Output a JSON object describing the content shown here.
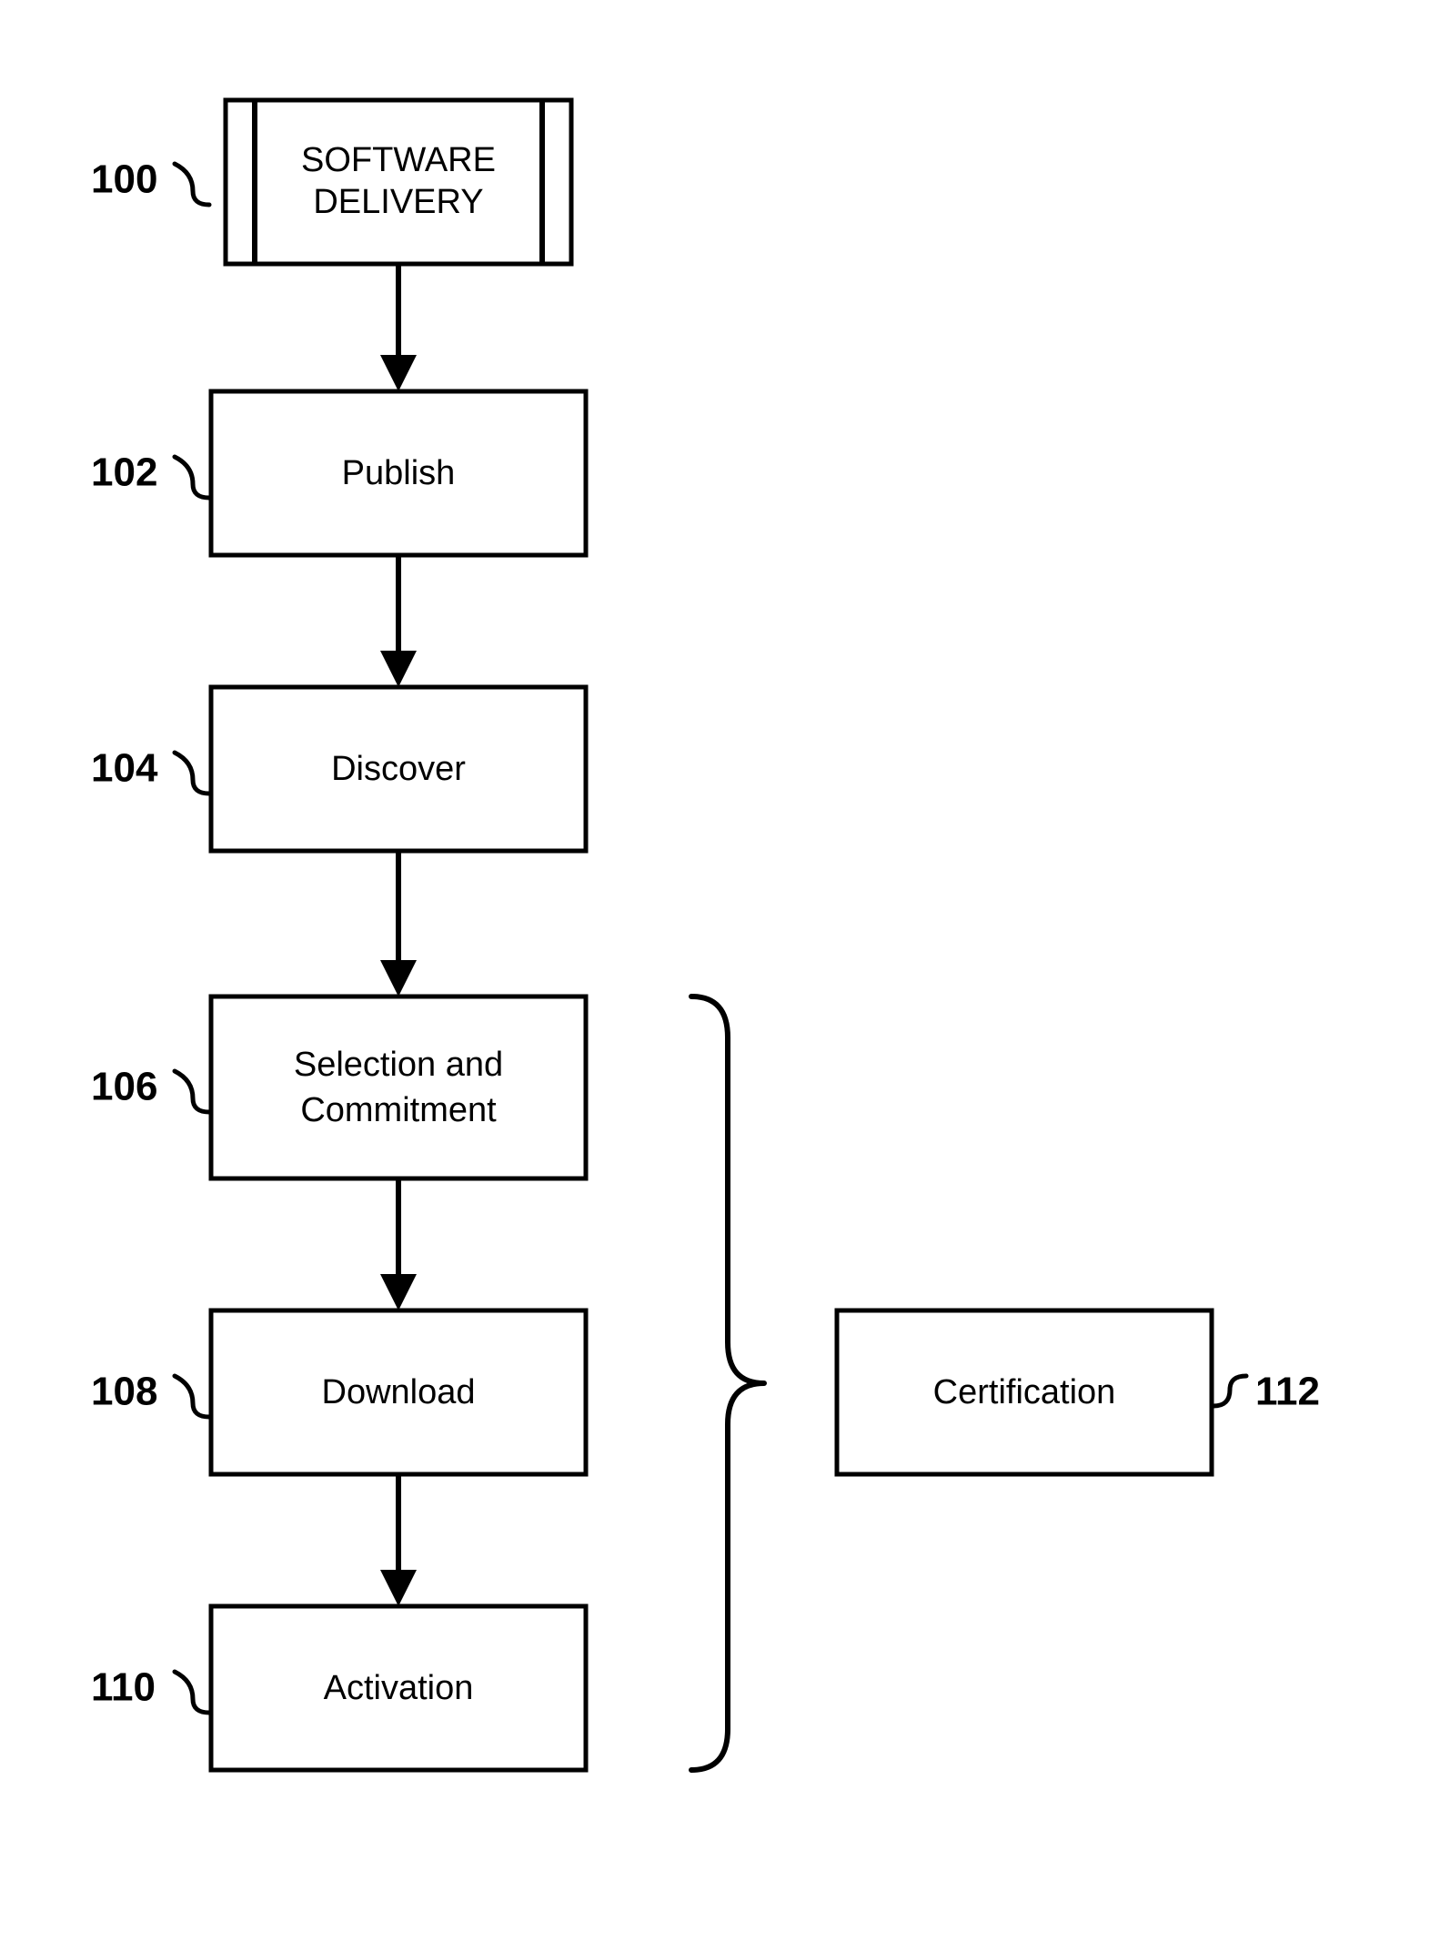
{
  "diagram": {
    "title": {
      "line1": "SOFTWARE",
      "line2": "DELIVERY"
    },
    "steps": {
      "publish": "Publish",
      "discover": "Discover",
      "selection_l1": "Selection and",
      "selection_l2": "Commitment",
      "download": "Download",
      "activation": "Activation",
      "certification": "Certification"
    },
    "refs": {
      "r100": "100",
      "r102": "102",
      "r104": "104",
      "r106": "106",
      "r108": "108",
      "r110": "110",
      "r112": "112"
    }
  }
}
